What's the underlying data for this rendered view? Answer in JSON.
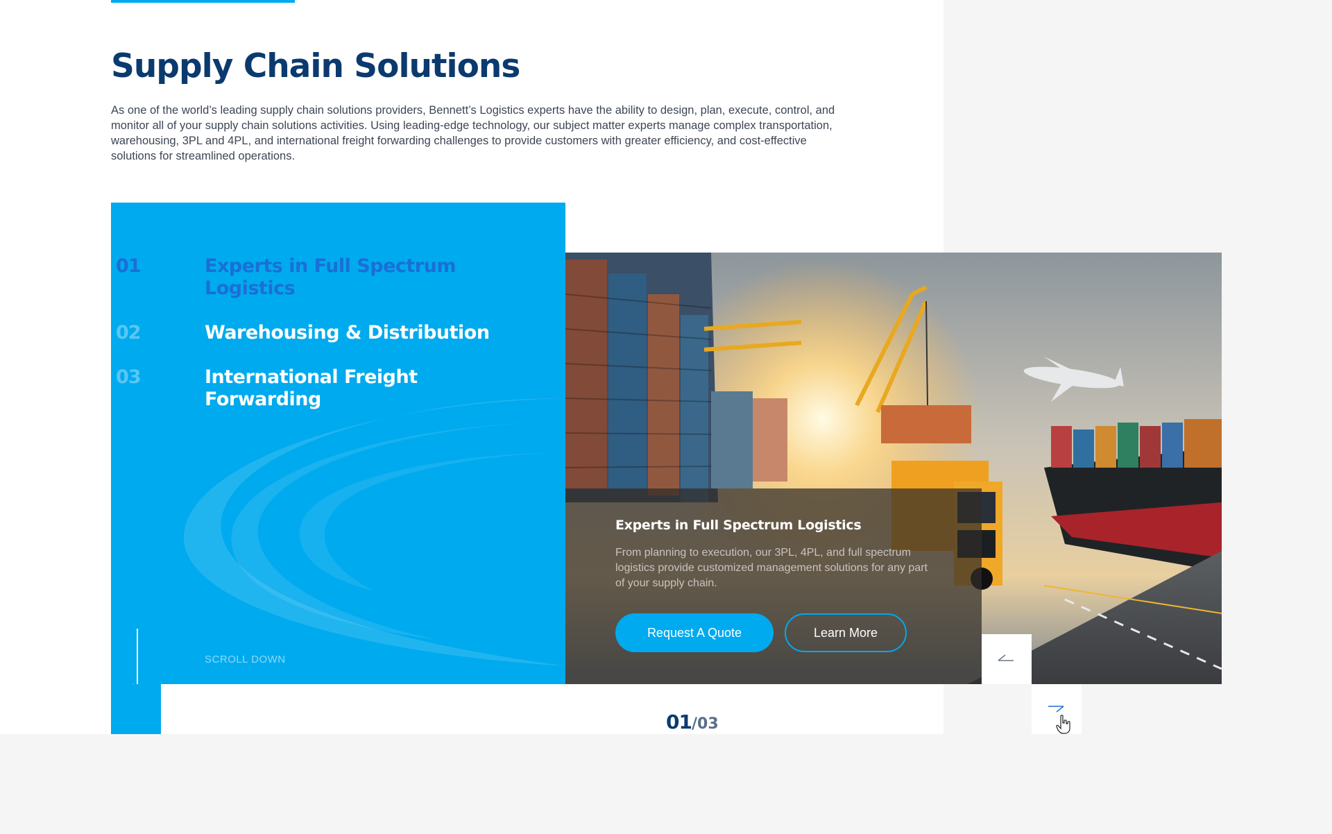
{
  "header": {
    "title": "Supply Chain Solutions",
    "intro": "As one of the world’s leading supply chain solutions providers, Bennett’s Logistics experts have the ability to design, plan, execute, control, and monitor all of your supply chain solutions activities. Using leading-edge technology, our subject matter experts manage complex transportation, warehousing, 3PL and 4PL, and international freight forwarding challenges to provide customers with greater efficiency, and cost-effective solutions for streamlined operations."
  },
  "menu": {
    "items": [
      {
        "num": "01",
        "label": "Experts in Full Spectrum Logistics",
        "active": true
      },
      {
        "num": "02",
        "label": "Warehousing & Distribution",
        "active": false
      },
      {
        "num": "03",
        "label": "International Freight Forwarding",
        "active": false
      }
    ],
    "scroll_label": "SCROLL DOWN"
  },
  "card": {
    "title": "Experts in Full Spectrum Logistics",
    "text": "From planning to execution, our 3PL, 4PL, and full spectrum logistics provide customized management solutions for any part of your supply chain.",
    "primary_button": "Request A Quote",
    "secondary_button": "Learn More"
  },
  "slider": {
    "current": "01",
    "separator": "/",
    "total": "03"
  },
  "icons": {
    "prev": "arrow-left-icon",
    "next": "arrow-right-icon",
    "scroll": "arrow-down-icon",
    "cursor": "hand-cursor-icon"
  },
  "colors": {
    "brand_blue": "#00aaee",
    "navy": "#0b3a6e",
    "active_item": "#1a6fd6"
  }
}
